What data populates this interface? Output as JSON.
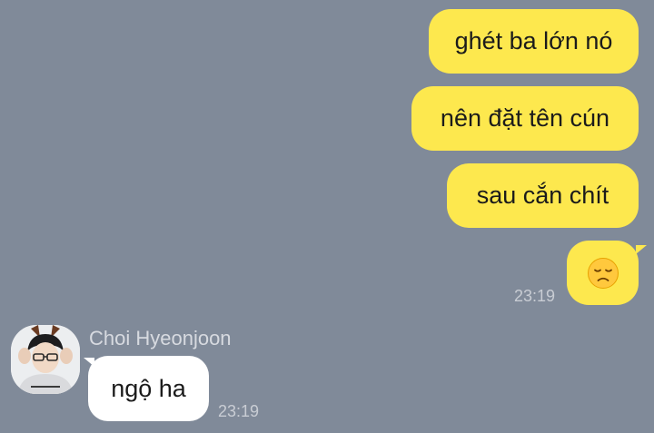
{
  "messages_out": [
    {
      "text": "ghét ba lớn nó"
    },
    {
      "text": "nên đặt tên cún"
    },
    {
      "text": "sau cắn chít"
    }
  ],
  "emoji_message": {
    "icon": "disappointed-face-emoji",
    "time": "23:19"
  },
  "incoming": {
    "sender": "Choi Hyeonjoon",
    "text": "ngộ ha",
    "time": "23:19"
  },
  "colors": {
    "background": "#808a99",
    "outgoing_bubble": "#fde84e",
    "incoming_bubble": "#ffffff"
  }
}
